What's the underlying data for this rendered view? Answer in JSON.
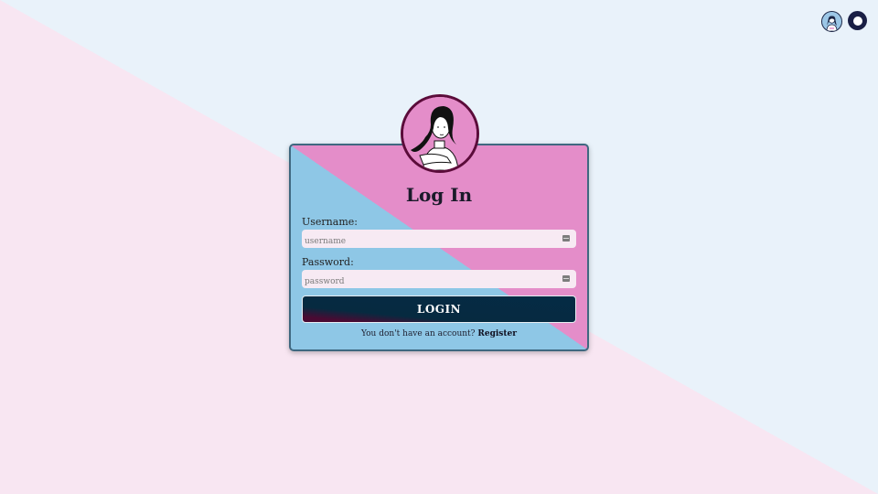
{
  "header": {
    "icons": [
      "avatar-icon",
      "theme-toggle-icon"
    ]
  },
  "login": {
    "title": "Log In",
    "username_label": "Username:",
    "username_placeholder": "username",
    "password_label": "Password:",
    "password_placeholder": "password",
    "button_label": "LOGIN",
    "register_prompt": "You don't have an account?",
    "register_link": "Register"
  },
  "colors": {
    "bg_pink": "#f8e6f2",
    "bg_blue": "#e9f2fa",
    "card_pink": "#e48dc9",
    "card_blue": "#8ec7e6",
    "button_dark": "#052b45",
    "accent_maroon": "#5b0c3a"
  }
}
